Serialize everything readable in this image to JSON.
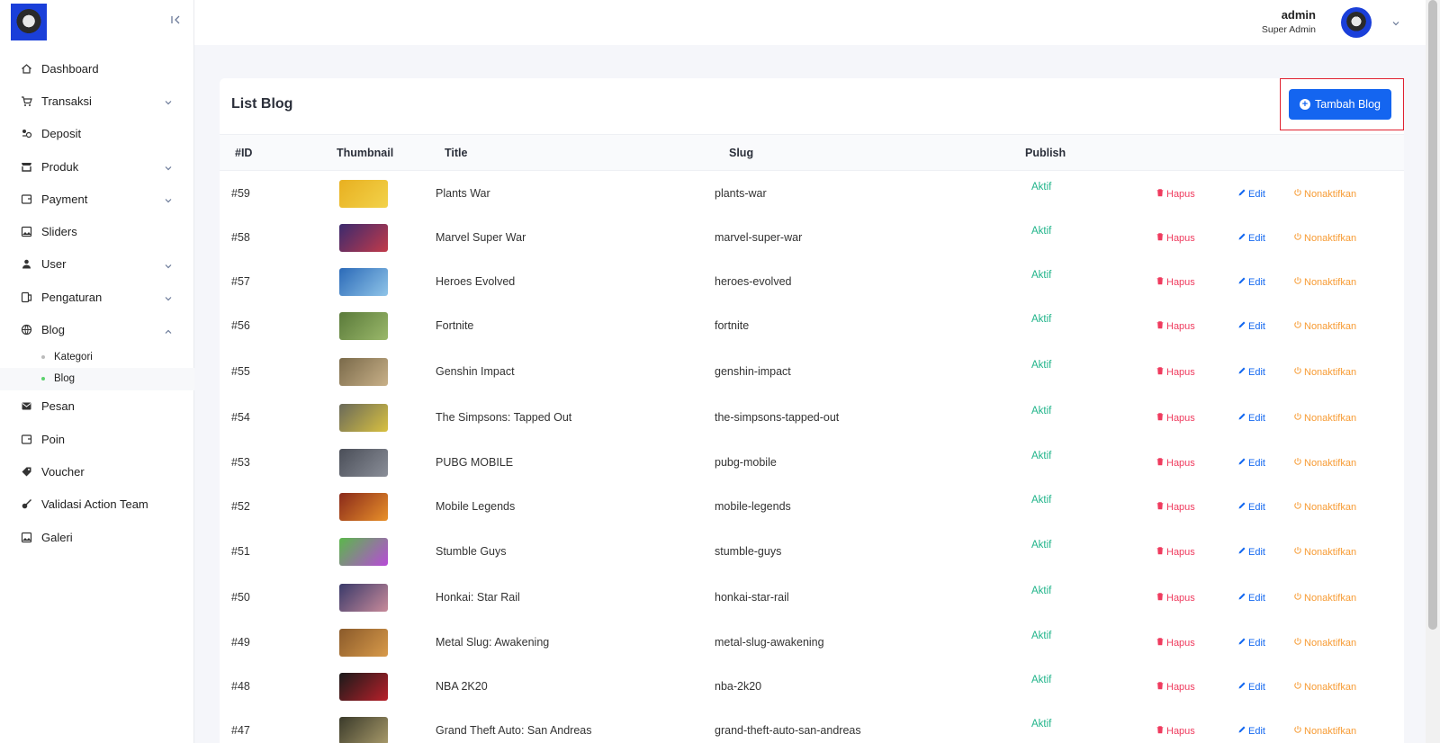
{
  "sidebar": {
    "collapse_icon": "collapse-left-icon",
    "items": [
      {
        "label": "Dashboard",
        "icon": "home-icon",
        "has_children": false
      },
      {
        "label": "Transaksi",
        "icon": "cart-icon",
        "has_children": true
      },
      {
        "label": "Deposit",
        "icon": "coins-icon",
        "has_children": false
      },
      {
        "label": "Produk",
        "icon": "store-icon",
        "has_children": true
      },
      {
        "label": "Payment",
        "icon": "wallet-icon",
        "has_children": true
      },
      {
        "label": "Sliders",
        "icon": "image-icon",
        "has_children": false
      },
      {
        "label": "User",
        "icon": "user-icon",
        "has_children": true
      },
      {
        "label": "Pengaturan",
        "icon": "settings-icon",
        "has_children": true
      },
      {
        "label": "Blog",
        "icon": "globe-icon",
        "has_children": true,
        "expanded": true
      },
      {
        "label": "Pesan",
        "icon": "mail-icon",
        "has_children": false
      },
      {
        "label": "Poin",
        "icon": "wallet-icon",
        "has_children": false
      },
      {
        "label": "Voucher",
        "icon": "tag-icon",
        "has_children": false
      },
      {
        "label": "Validasi Action Team",
        "icon": "guitar-icon",
        "has_children": false
      },
      {
        "label": "Galeri",
        "icon": "image-icon",
        "has_children": false
      }
    ],
    "blog_children": [
      {
        "label": "Kategori",
        "active": false
      },
      {
        "label": "Blog",
        "active": true
      }
    ]
  },
  "header": {
    "user_name": "admin",
    "user_role": "Super Admin"
  },
  "main": {
    "title": "List Blog",
    "add_button": "Tambah Blog",
    "columns": [
      "#ID",
      "Thumbnail",
      "Title",
      "Slug",
      "Publish"
    ],
    "actions": {
      "delete": "Hapus",
      "edit": "Edit",
      "deactivate": "Nonaktifkan"
    },
    "rows": [
      {
        "id": "#59",
        "title": "Plants War",
        "slug": "plants-war",
        "status": "Aktif",
        "thumb_colors": [
          "#e8b020",
          "#f2d24a"
        ]
      },
      {
        "id": "#58",
        "title": "Marvel Super War",
        "slug": "marvel-super-war",
        "status": "Aktif",
        "thumb_colors": [
          "#3b2a6e",
          "#c23a4a"
        ]
      },
      {
        "id": "#57",
        "title": "Heroes Evolved",
        "slug": "heroes-evolved",
        "status": "Aktif",
        "thumb_colors": [
          "#2b6ab8",
          "#8fc4e8"
        ]
      },
      {
        "id": "#56",
        "title": "Fortnite",
        "slug": "fortnite",
        "status": "Aktif",
        "thumb_colors": [
          "#5a7a3a",
          "#9ab86a"
        ]
      },
      {
        "id": "#55",
        "title": "Genshin Impact",
        "slug": "genshin-impact",
        "status": "Aktif",
        "thumb_colors": [
          "#7a6a4a",
          "#c8b088"
        ]
      },
      {
        "id": "#54",
        "title": "The Simpsons: Tapped Out",
        "slug": "the-simpsons-tapped-out",
        "status": "Aktif",
        "thumb_colors": [
          "#6a6a5a",
          "#d8c040"
        ]
      },
      {
        "id": "#53",
        "title": "PUBG MOBILE",
        "slug": "pubg-mobile",
        "status": "Aktif",
        "thumb_colors": [
          "#4a4e58",
          "#8a8e98"
        ]
      },
      {
        "id": "#52",
        "title": "Mobile Legends",
        "slug": "mobile-legends",
        "status": "Aktif",
        "thumb_colors": [
          "#8a2a1a",
          "#e8902a"
        ]
      },
      {
        "id": "#51",
        "title": "Stumble Guys",
        "slug": "stumble-guys",
        "status": "Aktif",
        "thumb_colors": [
          "#5ab84a",
          "#b84ad8"
        ]
      },
      {
        "id": "#50",
        "title": "Honkai: Star Rail",
        "slug": "honkai-star-rail",
        "status": "Aktif",
        "thumb_colors": [
          "#3a3a6a",
          "#c88a9a"
        ]
      },
      {
        "id": "#49",
        "title": "Metal Slug: Awakening",
        "slug": "metal-slug-awakening",
        "status": "Aktif",
        "thumb_colors": [
          "#8a5a2a",
          "#d89a4a"
        ]
      },
      {
        "id": "#48",
        "title": "NBA 2K20",
        "slug": "nba-2k20",
        "status": "Aktif",
        "thumb_colors": [
          "#1a1a1a",
          "#b8202a"
        ]
      },
      {
        "id": "#47",
        "title": "Grand Theft Auto: San Andreas",
        "slug": "grand-theft-auto-san-andreas",
        "status": "Aktif",
        "thumb_colors": [
          "#3a3a2a",
          "#a89a6a"
        ]
      }
    ]
  }
}
